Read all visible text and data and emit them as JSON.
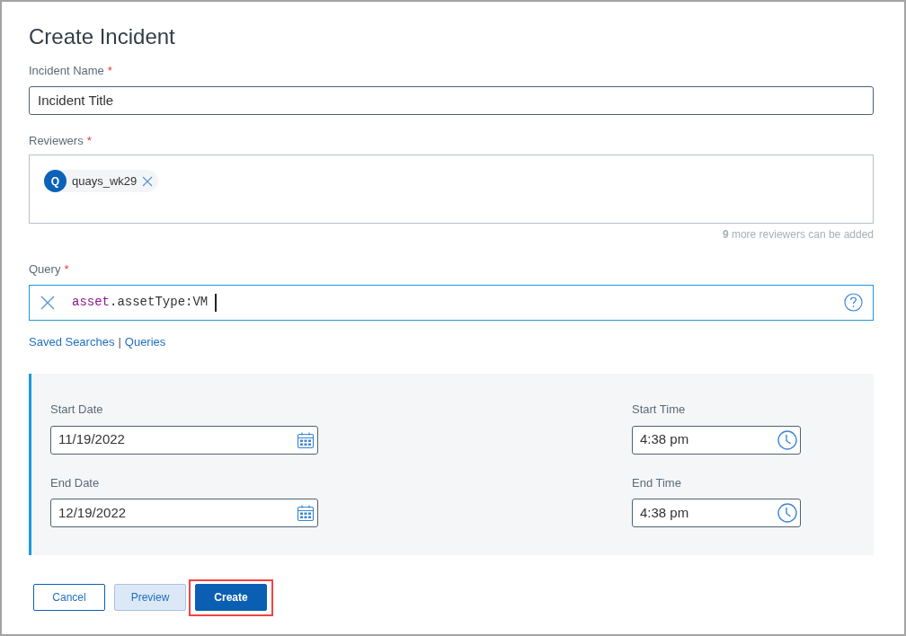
{
  "title": "Create Incident",
  "incident_name": {
    "label": "Incident Name",
    "required_mark": "*",
    "value": "Incident Title"
  },
  "reviewers": {
    "label": "Reviewers",
    "required_mark": "*",
    "chips": [
      {
        "initial": "Q",
        "name": "quays_wk29"
      }
    ],
    "hint": "**9** more reviewers can be added"
  },
  "query": {
    "label": "Query",
    "required_mark": "*",
    "focused": true,
    "tokens": [
      {
        "kind": "field",
        "text": "asset"
      },
      {
        "kind": "plain",
        "text": ".assetType:VM"
      }
    ]
  },
  "links": {
    "items": [
      "Saved Searches",
      "Queries"
    ],
    "separator": "|"
  },
  "schedule": [
    {
      "date_label": "Start Date",
      "date": "11/19/2022",
      "time_label": "Start Time",
      "time": "4:38 pm"
    },
    {
      "date_label": "End Date",
      "date": "12/19/2022",
      "time_label": "End Time",
      "time": "4:38 pm"
    }
  ],
  "buttons": [
    {
      "kind": "outline",
      "label": "Cancel",
      "highlighted": false
    },
    {
      "kind": "secondary",
      "label": "Preview",
      "highlighted": false
    },
    {
      "kind": "primary",
      "label": "Create",
      "highlighted": true
    }
  ]
}
